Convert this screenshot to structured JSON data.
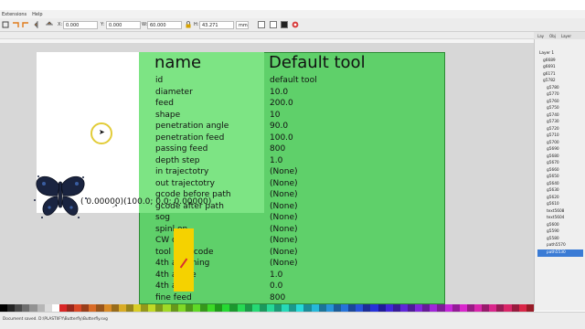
{
  "menubar": {
    "items": [
      "Extensions",
      "Help"
    ]
  },
  "toolbar": {
    "x_label": "X:",
    "x_value": "0.000",
    "y_label": "Y:",
    "y_value": "0.000",
    "w_label": "W:",
    "w_value": "60.000",
    "h_label": "H:",
    "h_value": "43.271",
    "unit": "mm"
  },
  "table": {
    "header_name": "name",
    "header_value": "Default tool",
    "rows": [
      {
        "key": "id",
        "value": "default tool"
      },
      {
        "key": "diameter",
        "value": "10.0"
      },
      {
        "key": "feed",
        "value": "200.0"
      },
      {
        "key": "shape",
        "value": "10"
      },
      {
        "key": "penetration angle",
        "value": "90.0"
      },
      {
        "key": "penetration feed",
        "value": "100.0"
      },
      {
        "key": "passing feed",
        "value": "800"
      },
      {
        "key": "depth step",
        "value": "1.0"
      },
      {
        "key": "in trajectotry",
        "value": "(None)"
      },
      {
        "key": "out trajectotry",
        "value": "(None)"
      },
      {
        "key": "gcode before path",
        "value": "(None)"
      },
      {
        "key": "gcode after path",
        "value": "(None)"
      },
      {
        "key": "sog",
        "value": "(None)"
      },
      {
        "key": "spinl  on",
        "value": "(None)"
      },
      {
        "key": "CW o  W",
        "value": "(None)"
      },
      {
        "key": "tool c  e gcode",
        "value": "(None)"
      },
      {
        "key": "4th a  leaning",
        "value": "(None)"
      },
      {
        "key": "4th a  cale",
        "value": "1.0"
      },
      {
        "key": "4th a  set",
        "value": "0.0"
      },
      {
        "key": "fine feed",
        "value": "800"
      }
    ]
  },
  "canvas": {
    "coords_text": "( 0.00000)(100.0; 0.0; 0.00000)"
  },
  "layers": {
    "tabs": [
      "Lay",
      "Obj",
      "Layer"
    ],
    "items": [
      {
        "label": "Layer 1",
        "selected": false,
        "top": true
      },
      {
        "label": "g6689",
        "selected": false,
        "top": false
      },
      {
        "label": "g6691",
        "selected": false,
        "top": false
      },
      {
        "label": "g6171",
        "selected": false,
        "top": false
      },
      {
        "label": "g5782",
        "selected": false,
        "top": false
      },
      {
        "label": "g5780",
        "selected": false,
        "top": false
      },
      {
        "label": "g5770",
        "selected": false,
        "top": false
      },
      {
        "label": "g5760",
        "selected": false,
        "top": false
      },
      {
        "label": "g5750",
        "selected": false,
        "top": false
      },
      {
        "label": "g5740",
        "selected": false,
        "top": false
      },
      {
        "label": "g5730",
        "selected": false,
        "top": false
      },
      {
        "label": "g5720",
        "selected": false,
        "top": false
      },
      {
        "label": "g5710",
        "selected": false,
        "top": false
      },
      {
        "label": "g5700",
        "selected": false,
        "top": false
      },
      {
        "label": "g5690",
        "selected": false,
        "top": false
      },
      {
        "label": "g5680",
        "selected": false,
        "top": false
      },
      {
        "label": "g5670",
        "selected": false,
        "top": false
      },
      {
        "label": "g5660",
        "selected": false,
        "top": false
      },
      {
        "label": "g5650",
        "selected": false,
        "top": false
      },
      {
        "label": "g5640",
        "selected": false,
        "top": false
      },
      {
        "label": "g5630",
        "selected": false,
        "top": false
      },
      {
        "label": "g5620",
        "selected": false,
        "top": false
      },
      {
        "label": "g5610",
        "selected": false,
        "top": false
      },
      {
        "label": "text5608",
        "selected": false,
        "top": false
      },
      {
        "label": "text5604",
        "selected": false,
        "top": false
      },
      {
        "label": "g5600",
        "selected": false,
        "top": false
      },
      {
        "label": "g5590",
        "selected": false,
        "top": false
      },
      {
        "label": "g5580",
        "selected": false,
        "top": false
      },
      {
        "label": "path5570",
        "selected": false,
        "top": false
      },
      {
        "label": "path5530",
        "selected": true,
        "top": false
      }
    ]
  },
  "status": {
    "text": "Document saved. D:\\PLASTIIFY\\Butterfly\\Butterfly.svg"
  },
  "colors": {
    "accent": "#3a7bd5",
    "panel_green": "#5fd06a",
    "panel_light": "#7de484",
    "cursor_ring": "#e2cc38",
    "yellow": "#f5d200",
    "butterfly": "#1a2440"
  }
}
